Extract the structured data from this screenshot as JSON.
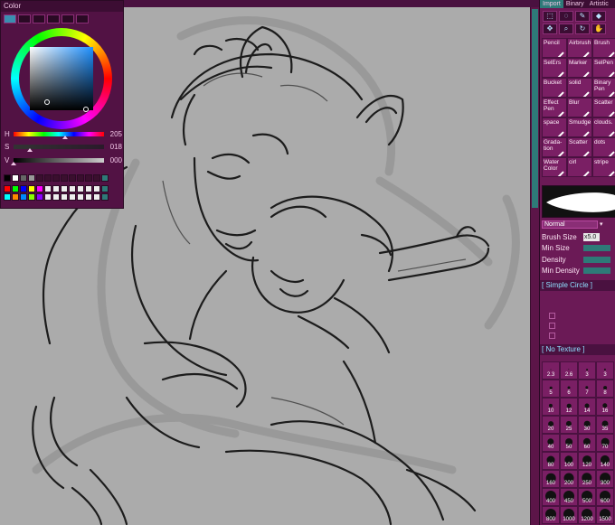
{
  "color_panel": {
    "title": "Color",
    "sliders": [
      {
        "label": "H",
        "value": "205",
        "pos": 0.57
      },
      {
        "label": "S",
        "value": "018",
        "pos": 0.18
      },
      {
        "label": "V",
        "value": "000",
        "pos": 0.0
      }
    ]
  },
  "right_panel": {
    "tabs": [
      "Import",
      "Binary",
      "Artistic"
    ],
    "brushes": [
      {
        "label": "Pencil"
      },
      {
        "label": "Airbrush"
      },
      {
        "label": "Brush"
      },
      {
        "label": "SelErs"
      },
      {
        "label": "Marker"
      },
      {
        "label": "SelPen"
      },
      {
        "label": "Bucket"
      },
      {
        "label": "solid"
      },
      {
        "label": "Binary Pen"
      },
      {
        "label": "Effect Pen"
      },
      {
        "label": "Blur"
      },
      {
        "label": "Scatter"
      },
      {
        "label": "space"
      },
      {
        "label": "Smudge"
      },
      {
        "label": "clouds."
      },
      {
        "label": "Grada-tion"
      },
      {
        "label": "Scatter"
      },
      {
        "label": "dots"
      },
      {
        "label": "Water Color"
      },
      {
        "label": "cirl"
      },
      {
        "label": "stripe"
      }
    ],
    "blend_mode": "Normal",
    "brush_size_label": "Brush Size",
    "brush_size_value": "x5.0",
    "min_size_label": "Min Size",
    "density_label": "Density",
    "min_density_label": "Min Density",
    "shape_section": "[ Simple Circle ]",
    "texture_section": "[ No Texture ]",
    "size_labels": [
      "2.3",
      "2.6",
      "3",
      "3",
      "5",
      "6",
      "7",
      "8",
      "10",
      "12",
      "14",
      "16",
      "20",
      "25",
      "30",
      "35",
      "40",
      "50",
      "60",
      "70",
      "80",
      "100",
      "120",
      "140",
      "160",
      "200",
      "250",
      "300",
      "400",
      "450",
      "500",
      "600",
      "800",
      "1000",
      "1200",
      "1500"
    ]
  },
  "colors": {
    "panel_bg": "#521244",
    "accent_teal": "#2e7a78",
    "canvas_bg": "#ababab"
  }
}
